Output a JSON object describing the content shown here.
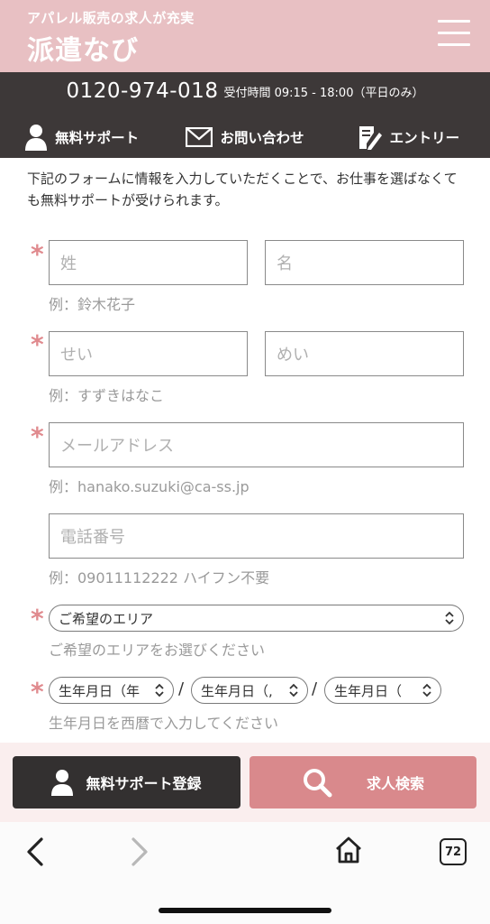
{
  "header": {
    "tagline": "アパレル販売の求人が充実",
    "logo": "派遣なび",
    "menu_icon": "hamburger-icon"
  },
  "contact_bar": {
    "phone": "0120-974-018",
    "hours": "受付時間 09:15 - 18:00（平日のみ）",
    "nav": [
      {
        "label": "無料サポート",
        "icon": "person-icon"
      },
      {
        "label": "お問い合わせ",
        "icon": "mail-icon"
      },
      {
        "label": "エントリー",
        "icon": "edit-document-icon"
      }
    ]
  },
  "form": {
    "intro": "下記のフォームに情報を入力していただくことで、お仕事を選ばなくても無料サポートが受けられます。",
    "required_mark": "*",
    "last_name_placeholder": "姓",
    "first_name_placeholder": "名",
    "name_hint": "例：鈴木花子",
    "last_kana_placeholder": "せい",
    "first_kana_placeholder": "めい",
    "kana_hint": "例：すずきはなこ",
    "email_placeholder": "メールアドレス",
    "email_hint": "例：hanako.suzuki@ca-ss.jp",
    "phone_placeholder": "電話番号",
    "phone_hint": "例：09011112222 ハイフン不要",
    "area_select": "ご希望のエリア",
    "area_hint": "ご希望のエリアをお選びください",
    "birth_year": "生年月日（年",
    "birth_month": "生年月日（,",
    "birth_day": "生年月日（",
    "date_separator": "/",
    "birth_hint": "生年月日を西暦で入力してください"
  },
  "actions": {
    "support_label": "無料サポート登録",
    "search_label": "求人検索",
    "support_icon": "person-icon",
    "search_icon": "search-icon"
  },
  "browser": {
    "tab_count": "72",
    "icons": [
      "back-icon",
      "forward-icon",
      "home-icon",
      "tabs-icon"
    ]
  },
  "colors": {
    "header_pink": "#e8c0c3",
    "dark_bar": "#3d3838",
    "required": "#e08a8e",
    "search_button": "#d9898c"
  }
}
